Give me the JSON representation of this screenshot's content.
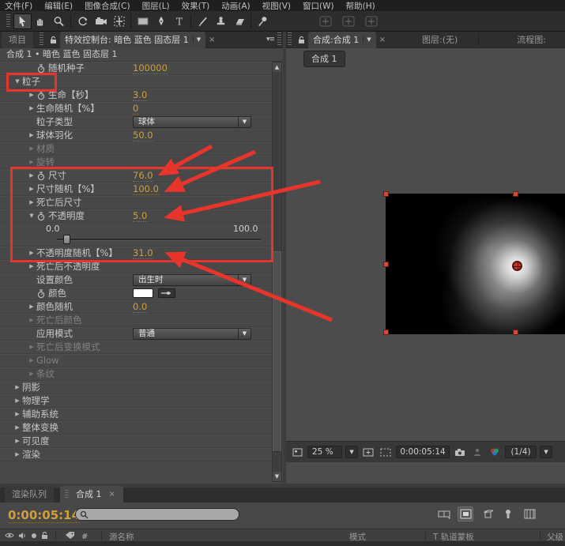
{
  "colors": {
    "accent_value": "#CF9F3C",
    "annotation_red": "#E8352C",
    "selection_handle_red": "#CD4B3B",
    "color_swatch": "#FFFFFF",
    "layer_background": "#000000"
  },
  "menu": {
    "items": [
      "文件(F)",
      "编辑(E)",
      "图像合成(C)",
      "图层(L)",
      "效果(T)",
      "动画(A)",
      "视图(V)",
      "窗口(W)",
      "帮助(H)"
    ]
  },
  "toolbar": {
    "groups": [
      [
        "selection",
        "hand",
        "zoom"
      ],
      [
        "rotate",
        "camera",
        "pan-behind"
      ],
      [
        "rect",
        "pen",
        "text"
      ],
      [
        "brush",
        "stamp",
        "eraser"
      ],
      [
        "pin"
      ]
    ],
    "axis_tools": [
      "axis-local",
      "axis-world",
      "axis-view"
    ]
  },
  "effects_panel": {
    "project_tab": "项目",
    "effect_tab": "特效控制台: 暗色 蓝色 固态层 1",
    "breadcrumb": "合成 1 • 暗色 蓝色 固态层 1",
    "rows": [
      {
        "indent": 2,
        "stopwatch": true,
        "label": "随机种子",
        "type": "value",
        "value": "100000"
      },
      {
        "indent": 1,
        "twirl": "open",
        "label": "粒子",
        "type": "group"
      },
      {
        "indent": 2,
        "twirl": "closed",
        "stopwatch": true,
        "label": "生命【秒】",
        "type": "value",
        "value": "3.0"
      },
      {
        "indent": 2,
        "twirl": "closed",
        "label": "生命随机【%】",
        "type": "value",
        "value": "0"
      },
      {
        "indent": 2,
        "label": "粒子类型",
        "type": "dropdown",
        "value": "球体"
      },
      {
        "indent": 2,
        "twirl": "closed",
        "label": "球体羽化",
        "type": "value",
        "value": "50.0"
      },
      {
        "indent": 2,
        "twirl": "closed",
        "label": "材质",
        "type": "none",
        "disabled": true
      },
      {
        "indent": 2,
        "twirl": "closed",
        "label": "旋转",
        "type": "none",
        "disabled": true
      },
      {
        "indent": 2,
        "twirl": "closed",
        "stopwatch": true,
        "label": "尺寸",
        "type": "value",
        "value": "76.0"
      },
      {
        "indent": 2,
        "twirl": "closed",
        "label": "尺寸随机【%】",
        "type": "value",
        "value": "100.0"
      },
      {
        "indent": 2,
        "twirl": "closed",
        "label": "死亡后尺寸",
        "type": "none"
      },
      {
        "indent": 2,
        "twirl": "open",
        "stopwatch": true,
        "label": "不透明度",
        "type": "value",
        "value": "5.0"
      },
      {
        "type": "slider",
        "min": "0.0",
        "max": "100.0",
        "value": 5.0,
        "range": [
          0,
          100
        ]
      },
      {
        "indent": 2,
        "twirl": "closed",
        "label": "不透明度随机【%】",
        "type": "value",
        "value": "31.0"
      },
      {
        "indent": 2,
        "twirl": "closed",
        "label": "死亡后不透明度",
        "type": "none"
      },
      {
        "indent": 2,
        "label": "设置颜色",
        "type": "dropdown",
        "value": "出生时"
      },
      {
        "indent": 2,
        "stopwatch": true,
        "label": "颜色",
        "type": "color"
      },
      {
        "indent": 2,
        "twirl": "closed",
        "label": "颜色随机",
        "type": "value",
        "value": "0.0"
      },
      {
        "indent": 2,
        "twirl": "closed",
        "label": "死亡后颜色",
        "type": "none",
        "disabled": true
      },
      {
        "indent": 2,
        "label": "应用模式",
        "type": "dropdown",
        "value": "普通"
      },
      {
        "indent": 2,
        "twirl": "closed",
        "label": "死亡后变换模式",
        "type": "none",
        "disabled": true
      },
      {
        "indent": 2,
        "twirl": "closed",
        "label": "Glow",
        "type": "none",
        "disabled": true
      },
      {
        "indent": 2,
        "twirl": "closed",
        "label": "条纹",
        "type": "none",
        "disabled": true
      },
      {
        "indent": 1,
        "twirl": "closed",
        "label": "阴影",
        "type": "none"
      },
      {
        "indent": 1,
        "twirl": "closed",
        "label": "物理学",
        "type": "none"
      },
      {
        "indent": 1,
        "twirl": "closed",
        "label": "辅助系统",
        "type": "none"
      },
      {
        "indent": 1,
        "twirl": "closed",
        "label": "整体变换",
        "type": "none"
      },
      {
        "indent": 1,
        "twirl": "closed",
        "label": "可见度",
        "type": "none"
      },
      {
        "indent": 1,
        "twirl": "closed",
        "label": "渲染",
        "type": "none"
      }
    ]
  },
  "viewer": {
    "comp_tab": "合成:合成 1",
    "layer_tab": "图层:(无)",
    "flowchart_tab": "流程图:",
    "comp_chip": "合成 1",
    "zoom_level": "25 %",
    "timecode": "0:00:05:14",
    "resolution": "(1/4)"
  },
  "timeline": {
    "tabs": [
      "渲染队列",
      "合成 1"
    ],
    "timecode": "0:00:05:14",
    "search_value": "",
    "switch_icons": [
      "frame-blend",
      "draft-3d",
      "live-update",
      "motion-blur",
      "graph-editor"
    ],
    "columns": {
      "source_name": "源名称",
      "mode": "模式",
      "trkmat": "T 轨道蒙板",
      "parent": "父级"
    }
  }
}
